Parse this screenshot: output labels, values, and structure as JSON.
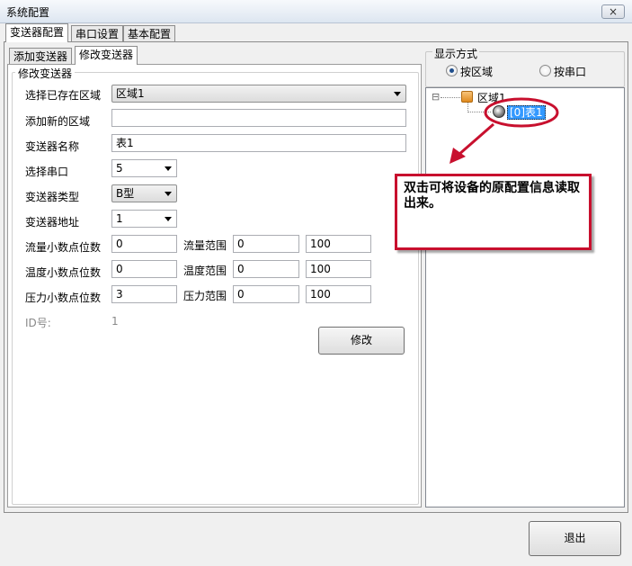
{
  "window": {
    "title": "系统配置",
    "close_icon": "×"
  },
  "tabs": [
    {
      "label": "变送器配置",
      "active": true
    },
    {
      "label": "串口设置"
    },
    {
      "label": "基本配置"
    }
  ],
  "subtabs": [
    {
      "label": "添加变送器"
    },
    {
      "label": "修改变送器",
      "active": true
    }
  ],
  "form": {
    "group_title": "修改变送器",
    "area_label": "选择已存在区域",
    "area_value": "区域1",
    "new_area_label": "添加新的区域",
    "new_area_value": "",
    "name_label": "变送器名称",
    "name_value": "表1",
    "port_label": "选择串口",
    "port_value": "5",
    "type_label": "变送器类型",
    "type_value": "B型",
    "address_label": "变送器地址",
    "address_value": "1",
    "flow_decimals_label": "流量小数点位数",
    "flow_decimals_value": "0",
    "flow_range_label": "流量范围",
    "flow_range_min": "0",
    "flow_range_max": "100",
    "temp_decimals_label": "温度小数点位数",
    "temp_decimals_value": "0",
    "temp_range_label": "温度范围",
    "temp_range_min": "0",
    "temp_range_max": "100",
    "pressure_decimals_label": "压力小数点位数",
    "pressure_decimals_value": "3",
    "pressure_range_label": "压力范围",
    "pressure_range_min": "0",
    "pressure_range_max": "100",
    "id_label": "ID号:",
    "id_value": "1",
    "modify_button": "修改"
  },
  "display": {
    "group_title": "显示方式",
    "by_area": "按区域",
    "by_port": "按串口",
    "selected": "by_area"
  },
  "tree": {
    "expander": "⊟",
    "area_node": "区域1",
    "device_node": "[0]表1"
  },
  "callout": {
    "text": "双击可将设备的原配置信息读取出来。"
  },
  "colors": {
    "callout_border": "#c8102e",
    "selection": "#3399ff"
  },
  "footer": {
    "exit_button": "退出"
  }
}
